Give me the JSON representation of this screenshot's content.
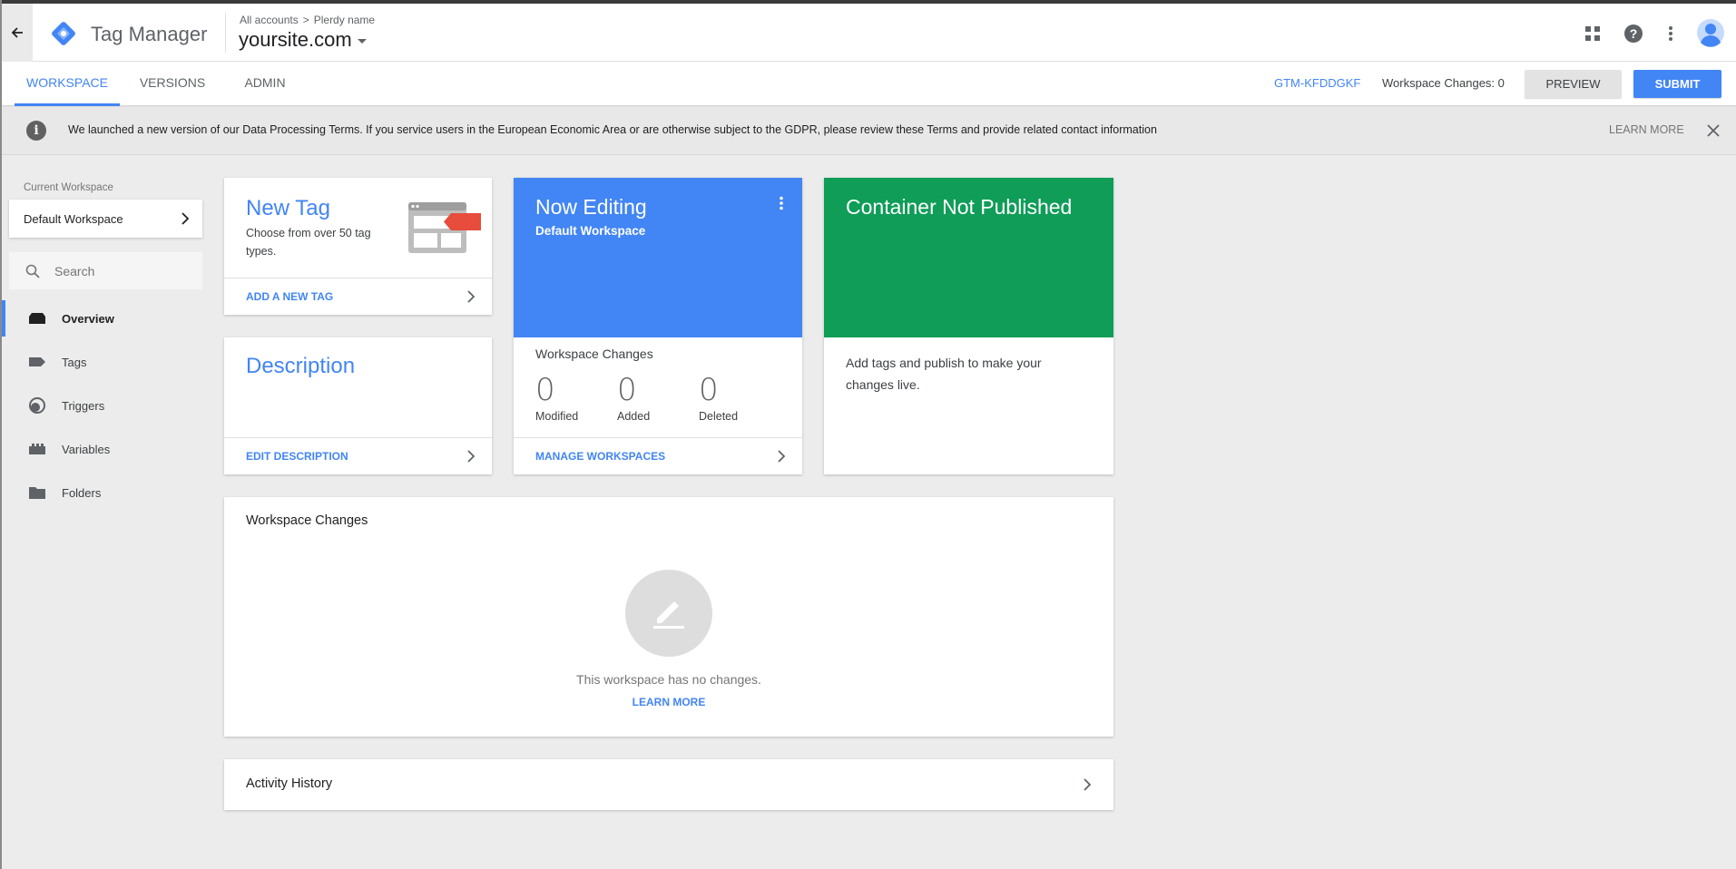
{
  "header": {
    "app_name": "Tag Manager",
    "breadcrumb": [
      "All accounts",
      "Plerdy name"
    ],
    "container_name": "yoursite.com",
    "icons": [
      "arrow-back-icon",
      "apps-grid-icon",
      "help-icon",
      "more-vert-icon",
      "account-avatar"
    ]
  },
  "tabs": [
    {
      "label": "WORKSPACE",
      "active": true
    },
    {
      "label": "VERSIONS",
      "active": false
    },
    {
      "label": "ADMIN",
      "active": false
    }
  ],
  "toolbar": {
    "container_id": "GTM-KFDDGKF",
    "workspace_changes": "Workspace Changes: 0",
    "preview_label": "PREVIEW",
    "submit_label": "SUBMIT"
  },
  "banner": {
    "text": "We launched a new version of our Data Processing Terms. If you service users in the European Economic Area or are otherwise subject to the GDPR, please review these Terms and provide related contact information",
    "learn_more": "LEARN MORE"
  },
  "sidebar": {
    "current_workspace_label": "Current Workspace",
    "current_workspace": "Default Workspace",
    "search_placeholder": "Search",
    "items": [
      {
        "label": "Overview",
        "icon": "overview-icon",
        "active": true
      },
      {
        "label": "Tags",
        "icon": "tag-icon",
        "active": false
      },
      {
        "label": "Triggers",
        "icon": "trigger-icon",
        "active": false
      },
      {
        "label": "Variables",
        "icon": "variables-icon",
        "active": false
      },
      {
        "label": "Folders",
        "icon": "folder-icon",
        "active": false
      }
    ]
  },
  "cards": {
    "new_tag": {
      "title": "New Tag",
      "desc": "Choose from over 50 tag types.",
      "link": "ADD A NEW TAG"
    },
    "description": {
      "title": "Description",
      "link": "EDIT DESCRIPTION"
    },
    "now_editing": {
      "title": "Now Editing",
      "subtitle": "Default Workspace",
      "changes_title": "Workspace Changes",
      "stats": [
        {
          "value": "0",
          "label": "Modified"
        },
        {
          "value": "0",
          "label": "Added"
        },
        {
          "value": "0",
          "label": "Deleted"
        }
      ],
      "link": "MANAGE WORKSPACES"
    },
    "not_published": {
      "title": "Container Not Published",
      "body": "Add tags and publish to make your changes live."
    },
    "workspace_changes": {
      "title": "Workspace Changes",
      "empty_text": "This workspace has no changes.",
      "learn_more": "LEARN MORE"
    },
    "activity": {
      "title": "Activity History"
    }
  },
  "colors": {
    "accent_blue": "#4285f4",
    "editing_blue": "#4285f4",
    "published_green": "#0f9d58",
    "tag_red": "#e74c3c"
  }
}
